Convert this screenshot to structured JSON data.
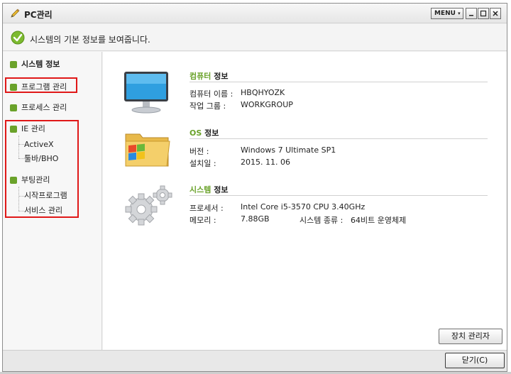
{
  "window": {
    "title": "PC관리",
    "menu_label": "MENU",
    "info_message": "시스템의 기본 정보를 보여줍니다."
  },
  "sidebar": {
    "items": [
      {
        "label": "시스템 정보",
        "bold": true
      },
      {
        "label": "프로그램 관리"
      },
      {
        "label": "프로세스 관리"
      },
      {
        "label": "IE 관리"
      },
      {
        "label": "부팅관리"
      }
    ],
    "ie_sub": [
      "ActiveX",
      "툴바/BHO"
    ],
    "boot_sub": [
      "시작프로그램",
      "서비스 관리"
    ]
  },
  "sections": {
    "computer": {
      "title_accent": "컴퓨터",
      "title_rest": " 정보",
      "rows": [
        {
          "label": "컴퓨터 이름 :",
          "value": "HBQHYOZK"
        },
        {
          "label": "작업 그룹 :",
          "value": "WORKGROUP"
        }
      ]
    },
    "os": {
      "title_accent": "OS",
      "title_rest": " 정보",
      "rows": [
        {
          "label": "버전 :",
          "value": "Windows 7 Ultimate SP1"
        },
        {
          "label": "설치일 :",
          "value": "2015. 11. 06"
        }
      ]
    },
    "system": {
      "title_accent": "시스템",
      "title_rest": " 정보",
      "rows": [
        {
          "label": "프로세서 :",
          "value": "Intel Core i5-3570 CPU 3.40GHz"
        },
        {
          "label": "메모리 :",
          "value": "7.88GB",
          "extra_label": "시스템 종류 :",
          "extra_value": "64비트 운영체제"
        }
      ]
    }
  },
  "buttons": {
    "device_manager": "장치 관리자",
    "close": "닫기(C)"
  },
  "colors": {
    "accent_green": "#6aa22a",
    "highlight_red": "#e01818"
  },
  "icons": [
    "pencil-icon",
    "check-circle-icon",
    "monitor-icon",
    "folder-windows-icon",
    "gears-icon"
  ]
}
